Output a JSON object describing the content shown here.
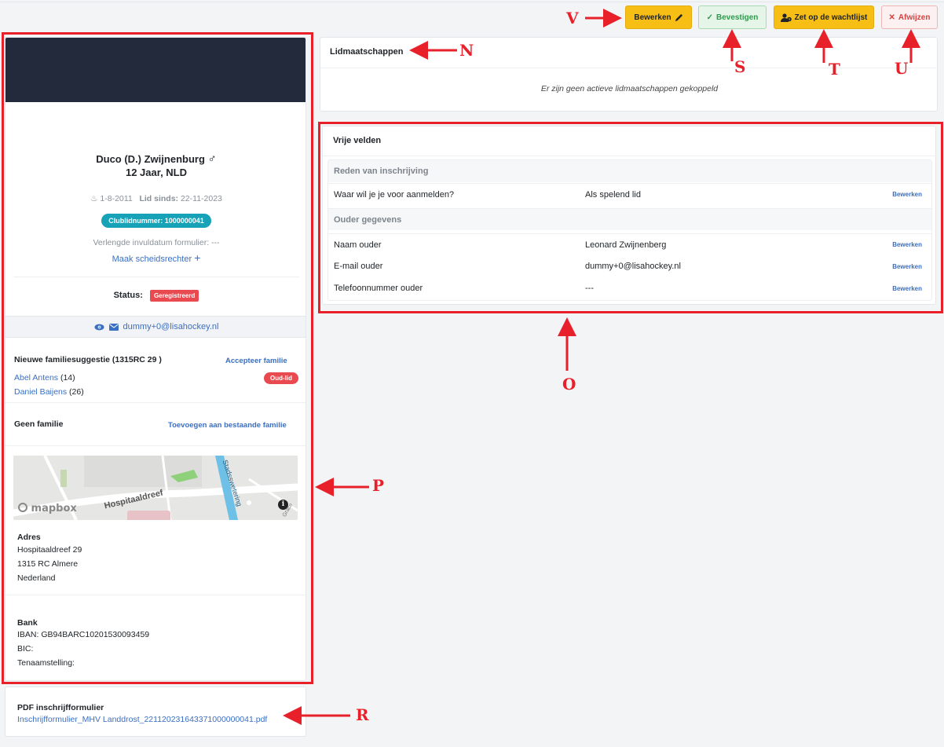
{
  "toolbar": {
    "edit": "Bewerken",
    "confirm": "Bevestigen",
    "waitlist": "Zet op de wachtlijst",
    "reject": "Afwijzen"
  },
  "profile": {
    "name": "Duco (D.) Zwijnenburg",
    "gender_symbol": "♂",
    "age_country": "12 Jaar, NLD",
    "birthdate": "1-8-2011",
    "member_since_label": "Lid sinds:",
    "member_since": "22-11-2023",
    "club_number": "Clublidnummer: 1000000041",
    "extended_date": "Verlengde invuldatum formulier: ---",
    "make_referee": "Maak scheidsrechter",
    "status_label": "Status:",
    "status_value": "Geregistreerd",
    "email": "dummy+0@lisahockey.nl"
  },
  "family": {
    "suggestion_title": "Nieuwe familiesuggestie (1315RC 29 )",
    "accept": "Accepteer familie",
    "member1_name": "Abel Antens",
    "member1_age": "(14)",
    "member1_badge": "Oud-lid",
    "member2_name": "Daniel Baijens",
    "member2_age": "(26)",
    "no_family": "Geen familie",
    "add_existing": "Toevoegen aan bestaande familie"
  },
  "map": {
    "street_label": "Hospitaaldreef",
    "canal_label": "Stadsswetering",
    "brand": "mapbox",
    "edge_label": "Grace"
  },
  "address": {
    "title": "Adres",
    "line1": "Hospitaaldreef 29",
    "line2": "1315 RC Almere",
    "line3": "Nederland"
  },
  "bank": {
    "title": "Bank",
    "iban": "IBAN: GB94BARC10201530093459",
    "bic": "BIC:",
    "holder": "Tenaamstelling:"
  },
  "pdf": {
    "title": "PDF inschrijfformulier",
    "file": "Inschrijfformulier_MHV Landdrost_22112023164337100000004​1.pdf"
  },
  "memberships": {
    "title": "Lidmaatschappen",
    "empty": "Er zijn geen actieve lidmaatschappen gekoppeld"
  },
  "free_fields": {
    "title": "Vrije velden",
    "section1": "Reden van inschrijving",
    "q1_label": "Waar wil je je voor aanmelden?",
    "q1_value": "Als spelend lid",
    "section2": "Ouder gegevens",
    "q2_label": "Naam ouder",
    "q2_value": "Leonard Zwijnenberg",
    "q3_label": "E-mail ouder",
    "q3_value": "dummy+0@lisahockey.nl",
    "q4_label": "Telefoonnummer ouder",
    "q4_value": "---",
    "edit_label": "Bewerken"
  },
  "annotations": {
    "N": "N",
    "O": "O",
    "P": "P",
    "R": "R",
    "S": "S",
    "T": "T",
    "U": "U",
    "V": "V"
  },
  "colors": {
    "header_dark": "#222a3c",
    "annotation_red": "#e8202a",
    "accent_blue": "#3b6fc1",
    "club_badge": "#17a2b8",
    "status_red": "#e84a4f",
    "button_yellow": "#f7be16"
  }
}
